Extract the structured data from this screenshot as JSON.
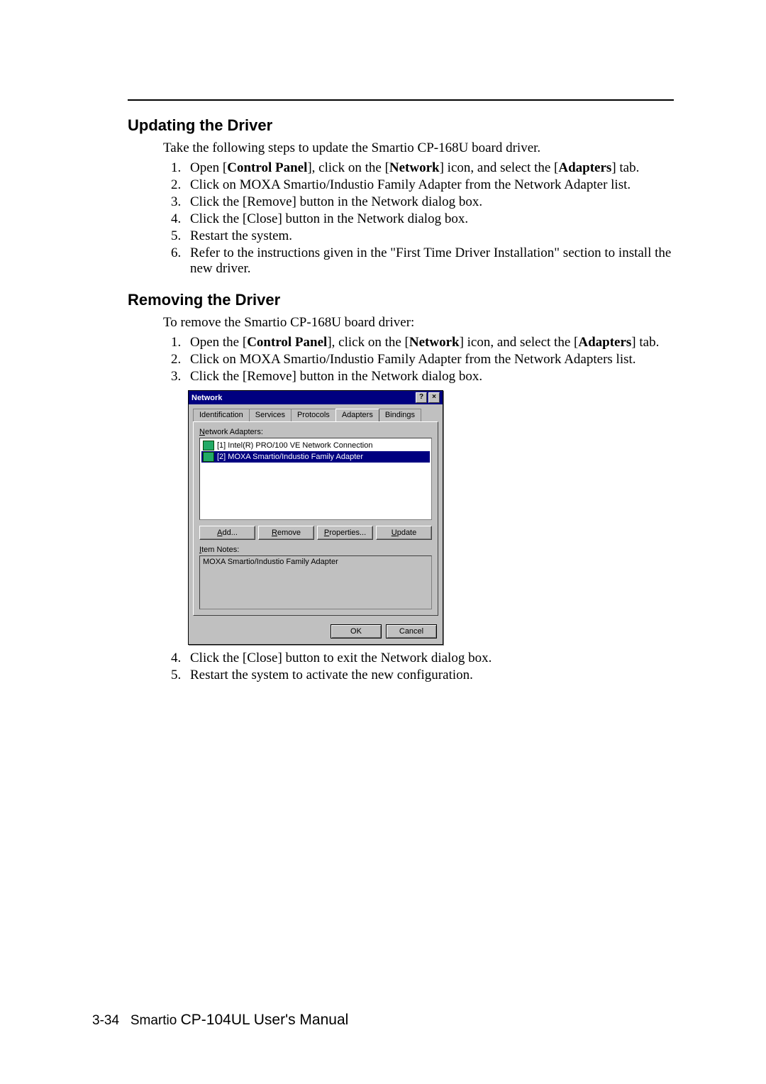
{
  "section1": {
    "heading": "Updating the Driver",
    "intro": "Take the following steps to update the Smartio CP-168U board driver.",
    "list": [
      {
        "pre": "Open [",
        "b1": "Control Panel",
        "mid1": "], click on the [",
        "b2": "Network",
        "mid2": "] icon, and select the [",
        "b3": "Adapters",
        "post": "] tab."
      },
      {
        "text": "Click on MOXA Smartio/Industio Family Adapter from the Network Adapter list."
      },
      {
        "text": "Click the [Remove] button in the Network dialog box."
      },
      {
        "text": "Click the [Close] button in the Network dialog box."
      },
      {
        "text": "Restart the system."
      },
      {
        "text": "Refer to the instructions given in the \"First Time Driver Installation\" section to install the new driver."
      }
    ]
  },
  "section2": {
    "heading": "Removing the Driver",
    "intro": "To remove the Smartio CP-168U board driver:",
    "listA": [
      {
        "pre": "Open the [",
        "b1": "Control Panel",
        "mid1": "], click on the [",
        "b2": "Network",
        "mid2": "] icon, and select the [",
        "b3": "Adapters",
        "post": "] tab."
      },
      {
        "text": "Click on MOXA Smartio/Industio Family Adapter from the Network Adapters list."
      },
      {
        "text": "Click the [Remove] button in the Network dialog box."
      }
    ],
    "listB_start": 4,
    "listB": [
      {
        "text": "Click the [Close] button to exit the Network dialog box."
      },
      {
        "text": "Restart the system to activate the new configuration."
      }
    ]
  },
  "dialog": {
    "title": "Network",
    "help_btn": "?",
    "close_btn": "×",
    "tabs": {
      "t1": "Identification",
      "t2": "Services",
      "t3": "Protocols",
      "t4": "Adapters",
      "t5": "Bindings"
    },
    "adapters_label_u": "N",
    "adapters_label_rest": "etwork Adapters:",
    "adapters_items": [
      "[1] Intel(R) PRO/100 VE Network Connection",
      "[2] MOXA Smartio/Industio Family Adapter"
    ],
    "buttons": {
      "add_u": "A",
      "add_rest": "dd...",
      "remove_u": "R",
      "remove_rest": "emove",
      "props_u": "P",
      "props_rest": "roperties...",
      "update_u": "U",
      "update_rest": "pdate"
    },
    "item_notes_label_u": "I",
    "item_notes_label_rest": "tem Notes:",
    "item_notes_value": "MOXA Smartio/Industio Family Adapter",
    "ok": "OK",
    "cancel": "Cancel"
  },
  "footer": {
    "pagenum": "3-34",
    "book_prefix": "Smartio ",
    "book_title": "CP-104UL User's Manual"
  }
}
